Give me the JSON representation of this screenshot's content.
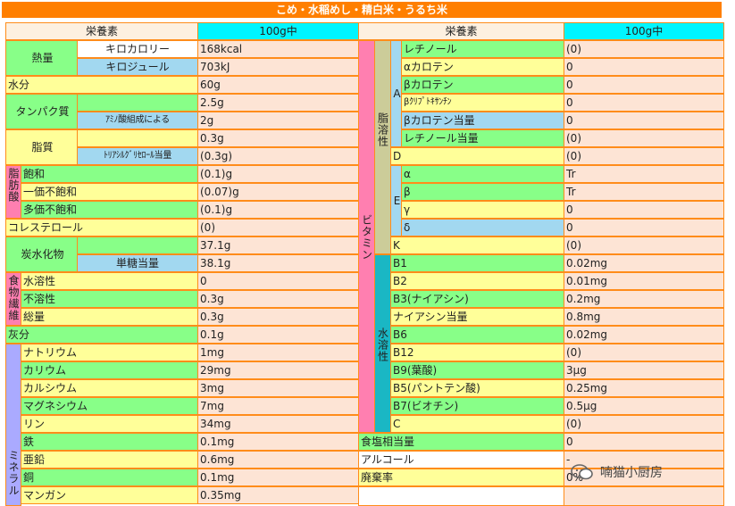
{
  "title": "こめ・水稲めし・精白米・うるち米",
  "header": {
    "nutrient": "栄養素",
    "per100g": "100g中"
  },
  "left": {
    "energy": "熱量",
    "kcal_label": "キロカロリー",
    "kcal": "168kcal",
    "kj_label": "キロジュール",
    "kj": "703kJ",
    "water": "水分",
    "water_v": "60g",
    "protein": "タンパク質",
    "protein_v": "2.5g",
    "amino_label": "ｱﾐﾉ酸組成による",
    "amino_v": "2g",
    "fat": "脂質",
    "fat_v": "0.3g",
    "tri_label": "ﾄﾘｱｼﾙｸﾞﾘｾﾛｰﾙ当量",
    "tri_v": "(0.3g)",
    "fatty_acid": "脂肪酸",
    "sat": "飽和",
    "sat_v": "(0.1)g",
    "mono": "一価不飽和",
    "mono_v": "(0.07)g",
    "poly": "多価不飽和",
    "poly_v": "(0.1)g",
    "chol": "コレステロール",
    "chol_v": "(0)",
    "carb": "炭水化物",
    "carb_v": "37.1g",
    "mono_sugar": "単糖当量",
    "mono_sugar_v": "38.1g",
    "fiber": "食物繊維",
    "sol": "水溶性",
    "sol_v": "0",
    "insol": "不溶性",
    "insol_v": "0.3g",
    "total": "総量",
    "total_v": "0.3g",
    "ash": "灰分",
    "ash_v": "0.1g",
    "mineral": "ミネラル",
    "minerals": [
      {
        "name": "ナトリウム",
        "value": "1mg"
      },
      {
        "name": "カリウム",
        "value": "29mg"
      },
      {
        "name": "カルシウム",
        "value": "3mg"
      },
      {
        "name": "マグネシウム",
        "value": "7mg"
      },
      {
        "name": "リン",
        "value": "34mg"
      },
      {
        "name": "鉄",
        "value": "0.1mg"
      },
      {
        "name": "亜鉛",
        "value": "0.6mg"
      },
      {
        "name": "銅",
        "value": "0.1mg"
      },
      {
        "name": "マンガン",
        "value": "0.35mg"
      }
    ]
  },
  "right": {
    "vitamin": "ビタミン",
    "fat_soluble": "脂溶性",
    "water_soluble": "水溶性",
    "a": "A",
    "retinol": "レチノール",
    "retinol_v": "(0)",
    "a_carotene": "αカロテン",
    "a_carotene_v": "0",
    "b_carotene": "βカロテン",
    "b_carotene_v": "0",
    "b_crypto": "βｸﾘﾌﾟﾄｷｻﾝﾁﾝ",
    "b_crypto_v": "0",
    "b_car_eq": "βカロテン当量",
    "b_car_eq_v": "0",
    "ret_eq": "レチノール当量",
    "ret_eq_v": "(0)",
    "d": "D",
    "d_v": "(0)",
    "e": "E",
    "e_alpha": "α",
    "e_alpha_v": "Tr",
    "e_beta": "β",
    "e_beta_v": "Tr",
    "e_gamma": "γ",
    "e_gamma_v": "0",
    "e_delta": "δ",
    "e_delta_v": "0",
    "k": "K",
    "k_v": "(0)",
    "b1": "B1",
    "b1_v": "0.02mg",
    "b2": "B2",
    "b2_v": "0.01mg",
    "b3": "B3(ナイアシン)",
    "b3_v": "0.2mg",
    "niacin_eq": "ナイアシン当量",
    "niacin_eq_v": "0.8mg",
    "b6": "B6",
    "b6_v": "0.02mg",
    "b12": "B12",
    "b12_v": "(0)",
    "b9": "B9(葉酸)",
    "b9_v": "3μg",
    "b5": "B5(パントテン酸)",
    "b5_v": "0.25mg",
    "b7": "B7(ビオチン)",
    "b7_v": "0.5μg",
    "c": "C",
    "c_v": "(0)",
    "salt": "食塩相当量",
    "salt_v": "0",
    "alcohol": "アルコール",
    "alcohol_v": "-",
    "waste": "廃棄率",
    "waste_v": "0%"
  },
  "watermark": "喃猫小厨房",
  "icons": {
    "watermark": "wechat-icon"
  }
}
